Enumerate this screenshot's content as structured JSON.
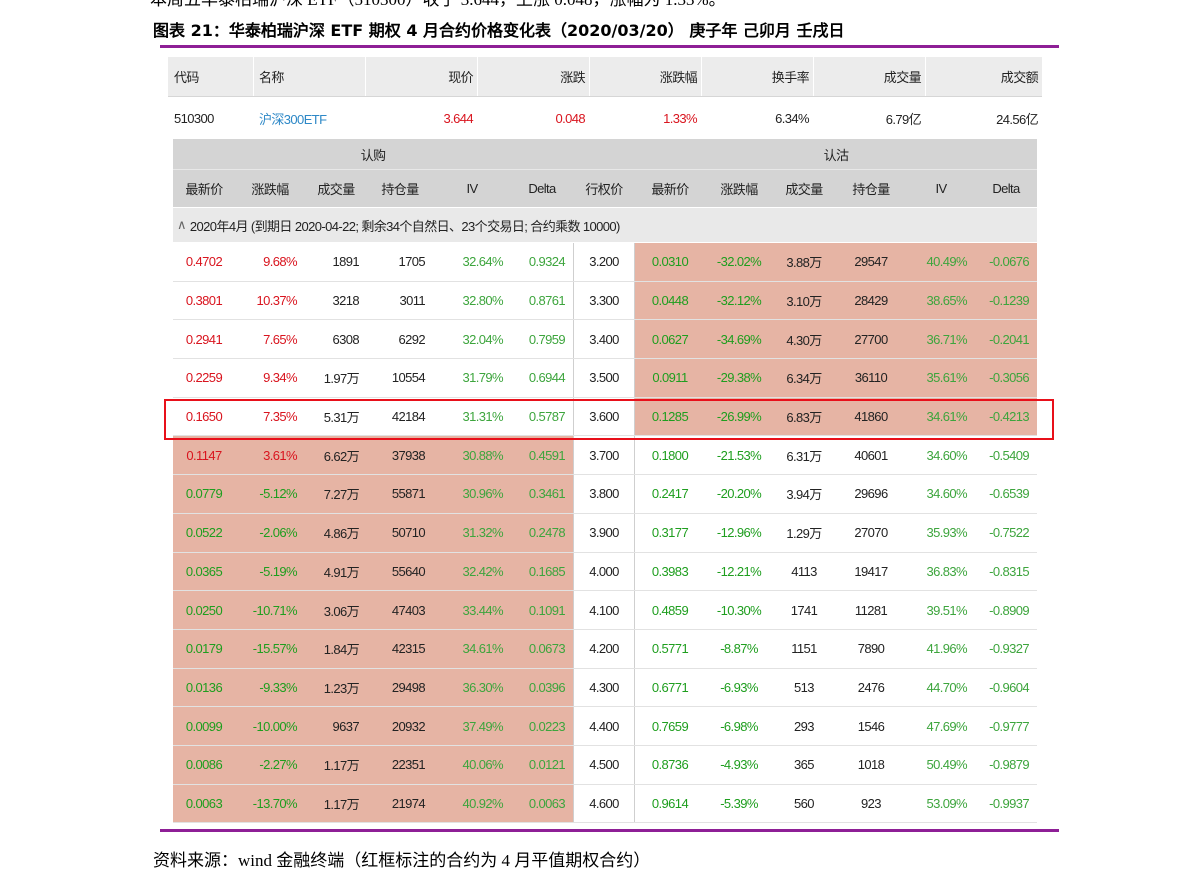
{
  "top_line": "本周五华泰柏瑞沪深 ETF（510300）收于 3.644，上涨 0.048，涨幅为 1.33%。",
  "figure_title": "图表 21：华泰柏瑞沪深 ETF 期权 4 月合约价格变化表（2020/03/20） 庚子年 己卯月 壬戌日",
  "source": "资料来源：wind 金融终端（红框标注的合约为 4 月平值期权合约）",
  "colors": {
    "accent_rule": "#8e1f96",
    "highlight_box": "#e8101a",
    "salmon_cell": "#e6b4a4",
    "up": "#d9141e",
    "down": "#1e9e1e"
  },
  "underlying": {
    "headers": [
      "代码",
      "名称",
      "现价",
      "涨跌",
      "涨跌幅",
      "换手率",
      "成交量",
      "成交额"
    ],
    "values": [
      "510300",
      "沪深300ETF",
      "3.644",
      "0.048",
      "1.33%",
      "6.34%",
      "6.79亿",
      "24.56亿"
    ]
  },
  "groups": {
    "call": "认购",
    "put": "认沽"
  },
  "columns": {
    "call": [
      "最新价",
      "涨跌幅",
      "成交量",
      "持仓量",
      "IV",
      "Delta"
    ],
    "strike": "行权价",
    "put": [
      "最新价",
      "涨跌幅",
      "成交量",
      "持仓量",
      "IV",
      "Delta"
    ]
  },
  "month_label": "2020年4月 (到期日 2020-04-22; 剩余34个自然日、23个交易日; 合约乘数 10000)",
  "highlight_strike": "3.600",
  "rows": [
    {
      "strike": "3.200",
      "call_itm": false,
      "put_itm": true,
      "call": [
        "0.4702",
        "9.68%",
        "1891",
        "1705",
        "32.64%",
        "0.9324"
      ],
      "put": [
        "0.0310",
        "-32.02%",
        "3.88万",
        "29547",
        "40.49%",
        "-0.0676"
      ]
    },
    {
      "strike": "3.300",
      "call_itm": false,
      "put_itm": true,
      "call": [
        "0.3801",
        "10.37%",
        "3218",
        "3011",
        "32.80%",
        "0.8761"
      ],
      "put": [
        "0.0448",
        "-32.12%",
        "3.10万",
        "28429",
        "38.65%",
        "-0.1239"
      ]
    },
    {
      "strike": "3.400",
      "call_itm": false,
      "put_itm": true,
      "call": [
        "0.2941",
        "7.65%",
        "6308",
        "6292",
        "32.04%",
        "0.7959"
      ],
      "put": [
        "0.0627",
        "-34.69%",
        "4.30万",
        "27700",
        "36.71%",
        "-0.2041"
      ]
    },
    {
      "strike": "3.500",
      "call_itm": false,
      "put_itm": true,
      "call": [
        "0.2259",
        "9.34%",
        "1.97万",
        "10554",
        "31.79%",
        "0.6944"
      ],
      "put": [
        "0.0911",
        "-29.38%",
        "6.34万",
        "36110",
        "35.61%",
        "-0.3056"
      ]
    },
    {
      "strike": "3.600",
      "call_itm": false,
      "put_itm": true,
      "call": [
        "0.1650",
        "7.35%",
        "5.31万",
        "42184",
        "31.31%",
        "0.5787"
      ],
      "put": [
        "0.1285",
        "-26.99%",
        "6.83万",
        "41860",
        "34.61%",
        "-0.4213"
      ]
    },
    {
      "strike": "3.700",
      "call_itm": true,
      "put_itm": false,
      "call": [
        "0.1147",
        "3.61%",
        "6.62万",
        "37938",
        "30.88%",
        "0.4591"
      ],
      "put": [
        "0.1800",
        "-21.53%",
        "6.31万",
        "40601",
        "34.60%",
        "-0.5409"
      ]
    },
    {
      "strike": "3.800",
      "call_itm": true,
      "put_itm": false,
      "call": [
        "0.0779",
        "-5.12%",
        "7.27万",
        "55871",
        "30.96%",
        "0.3461"
      ],
      "put": [
        "0.2417",
        "-20.20%",
        "3.94万",
        "29696",
        "34.60%",
        "-0.6539"
      ]
    },
    {
      "strike": "3.900",
      "call_itm": true,
      "put_itm": false,
      "call": [
        "0.0522",
        "-2.06%",
        "4.86万",
        "50710",
        "31.32%",
        "0.2478"
      ],
      "put": [
        "0.3177",
        "-12.96%",
        "1.29万",
        "27070",
        "35.93%",
        "-0.7522"
      ]
    },
    {
      "strike": "4.000",
      "call_itm": true,
      "put_itm": false,
      "call": [
        "0.0365",
        "-5.19%",
        "4.91万",
        "55640",
        "32.42%",
        "0.1685"
      ],
      "put": [
        "0.3983",
        "-12.21%",
        "4113",
        "19417",
        "36.83%",
        "-0.8315"
      ]
    },
    {
      "strike": "4.100",
      "call_itm": true,
      "put_itm": false,
      "call": [
        "0.0250",
        "-10.71%",
        "3.06万",
        "47403",
        "33.44%",
        "0.1091"
      ],
      "put": [
        "0.4859",
        "-10.30%",
        "1741",
        "11281",
        "39.51%",
        "-0.8909"
      ]
    },
    {
      "strike": "4.200",
      "call_itm": true,
      "put_itm": false,
      "call": [
        "0.0179",
        "-15.57%",
        "1.84万",
        "42315",
        "34.61%",
        "0.0673"
      ],
      "put": [
        "0.5771",
        "-8.87%",
        "1151",
        "7890",
        "41.96%",
        "-0.9327"
      ]
    },
    {
      "strike": "4.300",
      "call_itm": true,
      "put_itm": false,
      "call": [
        "0.0136",
        "-9.33%",
        "1.23万",
        "29498",
        "36.30%",
        "0.0396"
      ],
      "put": [
        "0.6771",
        "-6.93%",
        "513",
        "2476",
        "44.70%",
        "-0.9604"
      ]
    },
    {
      "strike": "4.400",
      "call_itm": true,
      "put_itm": false,
      "call": [
        "0.0099",
        "-10.00%",
        "9637",
        "20932",
        "37.49%",
        "0.0223"
      ],
      "put": [
        "0.7659",
        "-6.98%",
        "293",
        "1546",
        "47.69%",
        "-0.9777"
      ]
    },
    {
      "strike": "4.500",
      "call_itm": true,
      "put_itm": false,
      "call": [
        "0.0086",
        "-2.27%",
        "1.17万",
        "22351",
        "40.06%",
        "0.0121"
      ],
      "put": [
        "0.8736",
        "-4.93%",
        "365",
        "1018",
        "50.49%",
        "-0.9879"
      ]
    },
    {
      "strike": "4.600",
      "call_itm": true,
      "put_itm": false,
      "call": [
        "0.0063",
        "-13.70%",
        "1.17万",
        "21974",
        "40.92%",
        "0.0063"
      ],
      "put": [
        "0.9614",
        "-5.39%",
        "560",
        "923",
        "53.09%",
        "-0.9937"
      ]
    }
  ]
}
